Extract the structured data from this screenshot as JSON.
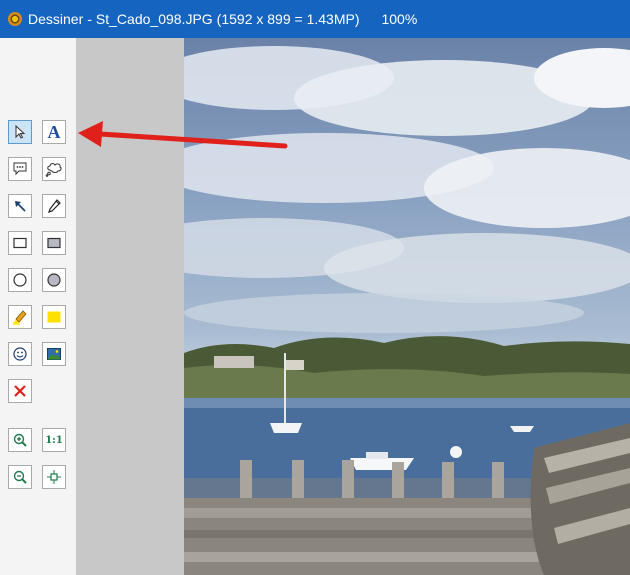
{
  "window": {
    "app_name": "Dessiner",
    "separator": "-",
    "file_name": "St_Cado_098.JPG",
    "image_info": "(1592 x 899 = 1.43MP)",
    "zoom": "100%"
  },
  "tools": {
    "select": {
      "icon": "pointer-icon"
    },
    "text": {
      "icon": "text-a-icon",
      "glyph": "A"
    },
    "speech_bubble": {
      "icon": "speech-bubble-icon"
    },
    "thought_bubble": {
      "icon": "thought-bubble-icon"
    },
    "arrow": {
      "icon": "arrow-icon"
    },
    "pencil": {
      "icon": "pencil-icon"
    },
    "rect_outline": {
      "icon": "rectangle-outline-icon"
    },
    "rect_filled": {
      "icon": "rectangle-filled-icon"
    },
    "ellipse_outline": {
      "icon": "ellipse-outline-icon"
    },
    "ellipse_filled": {
      "icon": "ellipse-filled-icon"
    },
    "highlighter": {
      "icon": "highlighter-icon"
    },
    "yellow_fill": {
      "icon": "yellow-fill-icon"
    },
    "emoji": {
      "icon": "smiley-icon"
    },
    "image": {
      "icon": "image-icon"
    },
    "delete": {
      "icon": "delete-x-icon"
    },
    "zoom_in": {
      "icon": "zoom-in-icon"
    },
    "actual_size": {
      "icon": "actual-size-icon",
      "label": "1:1"
    },
    "zoom_out": {
      "icon": "zoom-out-icon"
    },
    "fit": {
      "icon": "fit-window-icon"
    }
  },
  "colors": {
    "titlebar": "#1565c0",
    "active_tool": "#cce4f7",
    "annotation_arrow": "#e0211b",
    "delete_x": "#e0211b",
    "highlight_yellow": "#ffe100"
  }
}
